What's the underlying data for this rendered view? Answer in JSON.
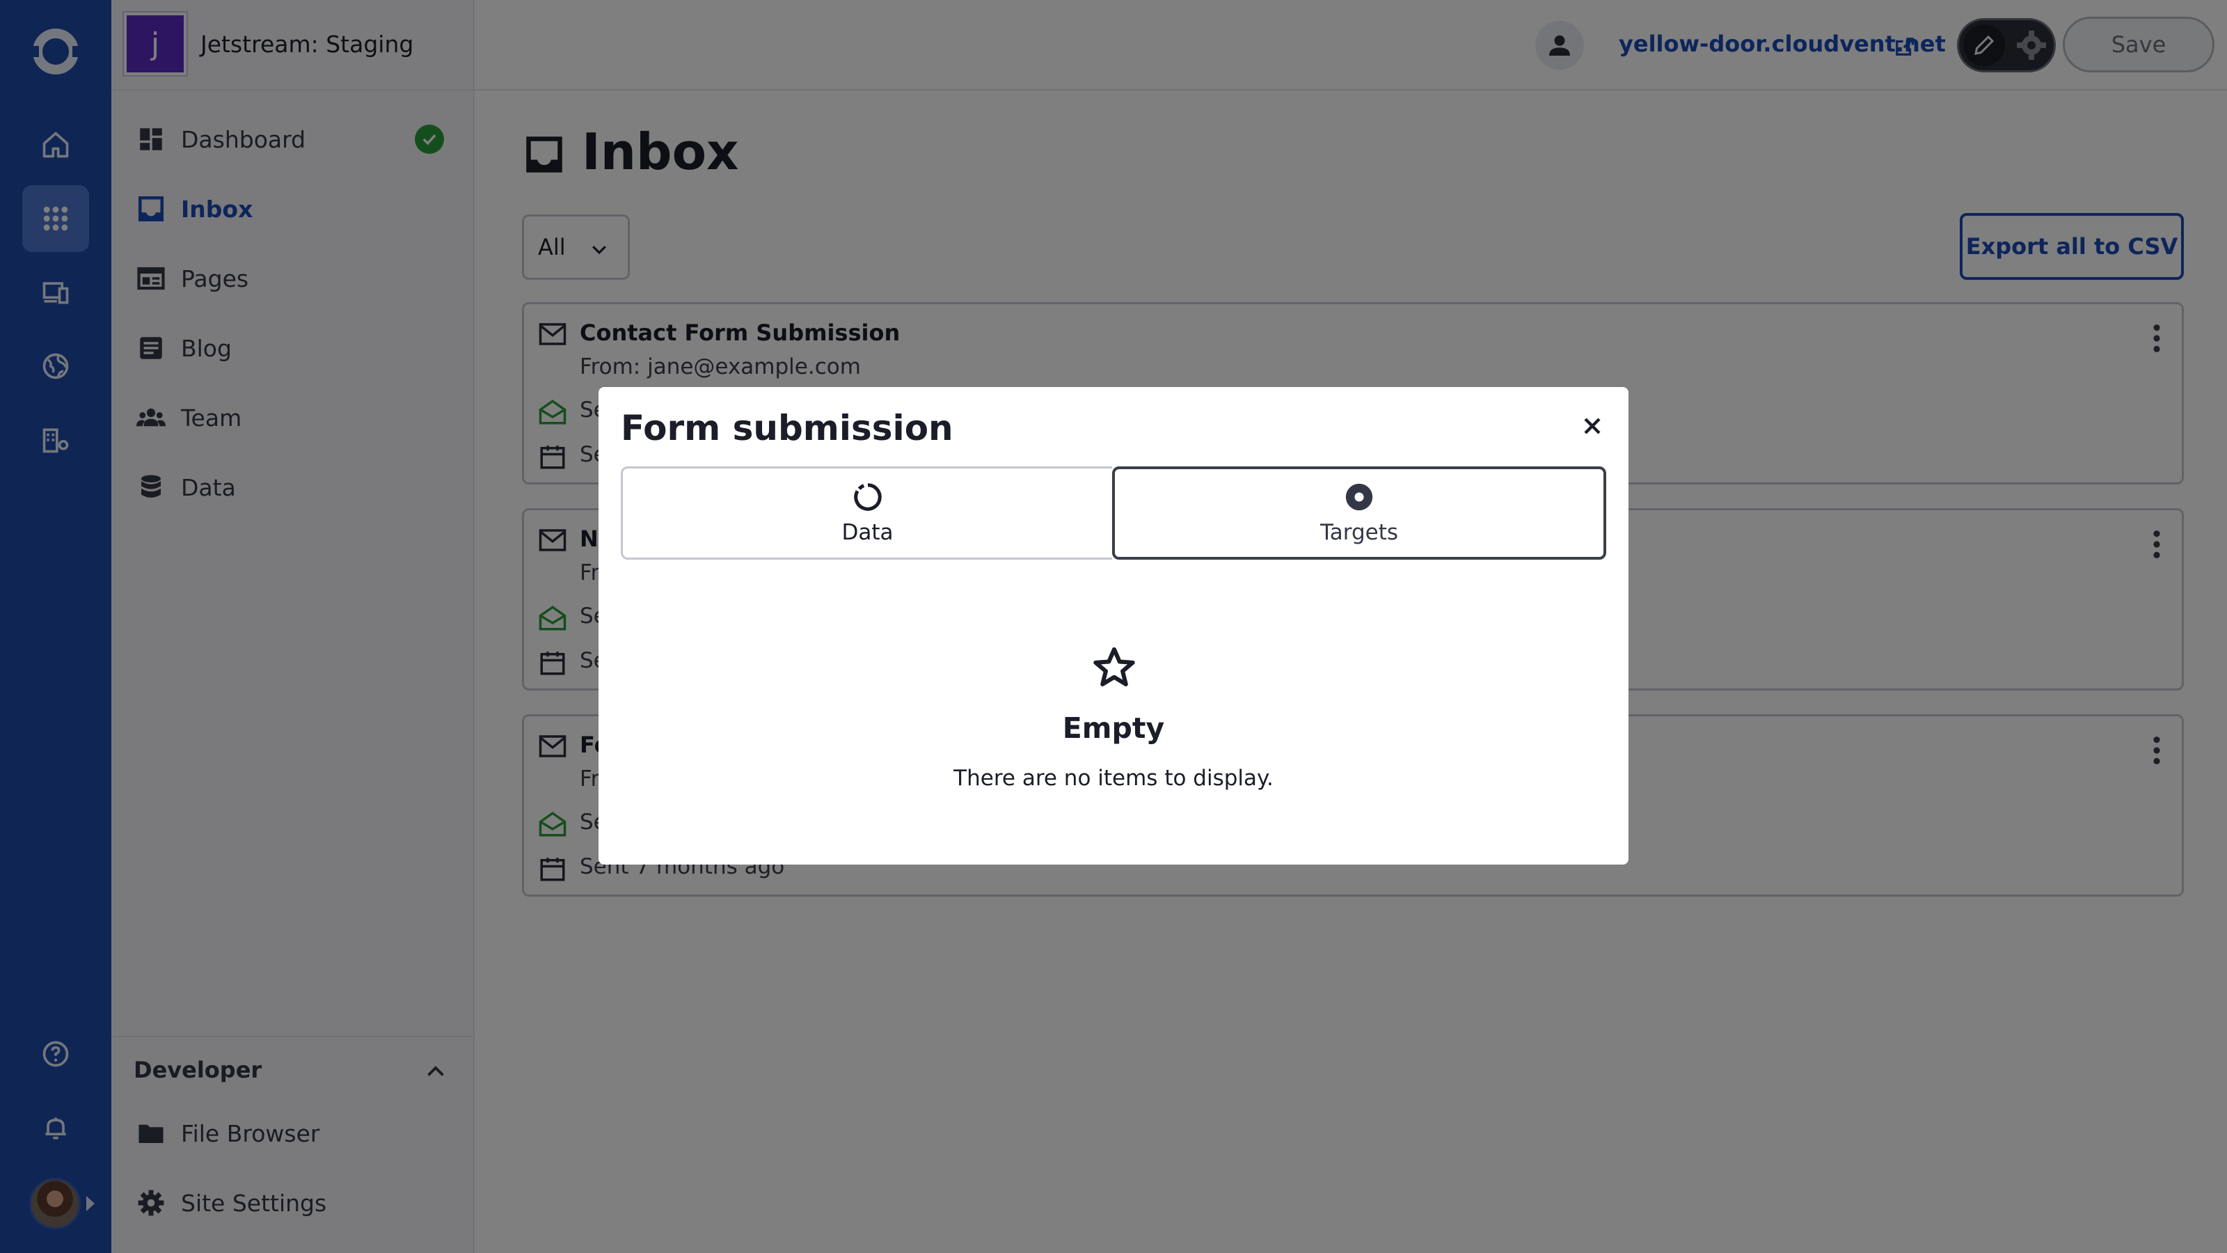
{
  "site": {
    "avatar_letter": "j",
    "name": "Jetstream: Staging"
  },
  "topbar": {
    "domain": "yellow-door.cloudvent.net",
    "save_label": "Save"
  },
  "sidebar": {
    "items": [
      {
        "label": "Dashboard"
      },
      {
        "label": "Inbox"
      },
      {
        "label": "Pages"
      },
      {
        "label": "Blog"
      },
      {
        "label": "Team"
      },
      {
        "label": "Data"
      }
    ],
    "developer": {
      "title": "Developer",
      "items": [
        {
          "label": "File Browser"
        },
        {
          "label": "Site Settings"
        }
      ]
    }
  },
  "main": {
    "title": "Inbox",
    "filter_value": "All",
    "export_label": "Export all to CSV",
    "cards": [
      {
        "title": "Contact Form Submission",
        "from": "From: jane@example.com",
        "status": "Se",
        "date": "Se"
      },
      {
        "title": "N",
        "from": "Fr",
        "status": "Se",
        "date": "Se"
      },
      {
        "title": "Fe",
        "from": "Fr",
        "status": "Se",
        "date": "Sent 7 months ago"
      }
    ]
  },
  "modal": {
    "title": "Form submission",
    "tabs": [
      {
        "label": "Data"
      },
      {
        "label": "Targets"
      }
    ],
    "empty_title": "Empty",
    "empty_text": "There are no items to display."
  },
  "colors": {
    "rail": "#1f4aa8",
    "accent": "#1b4bb6",
    "success": "#2b9c3a",
    "site_avatar": "#5a2bc4"
  }
}
